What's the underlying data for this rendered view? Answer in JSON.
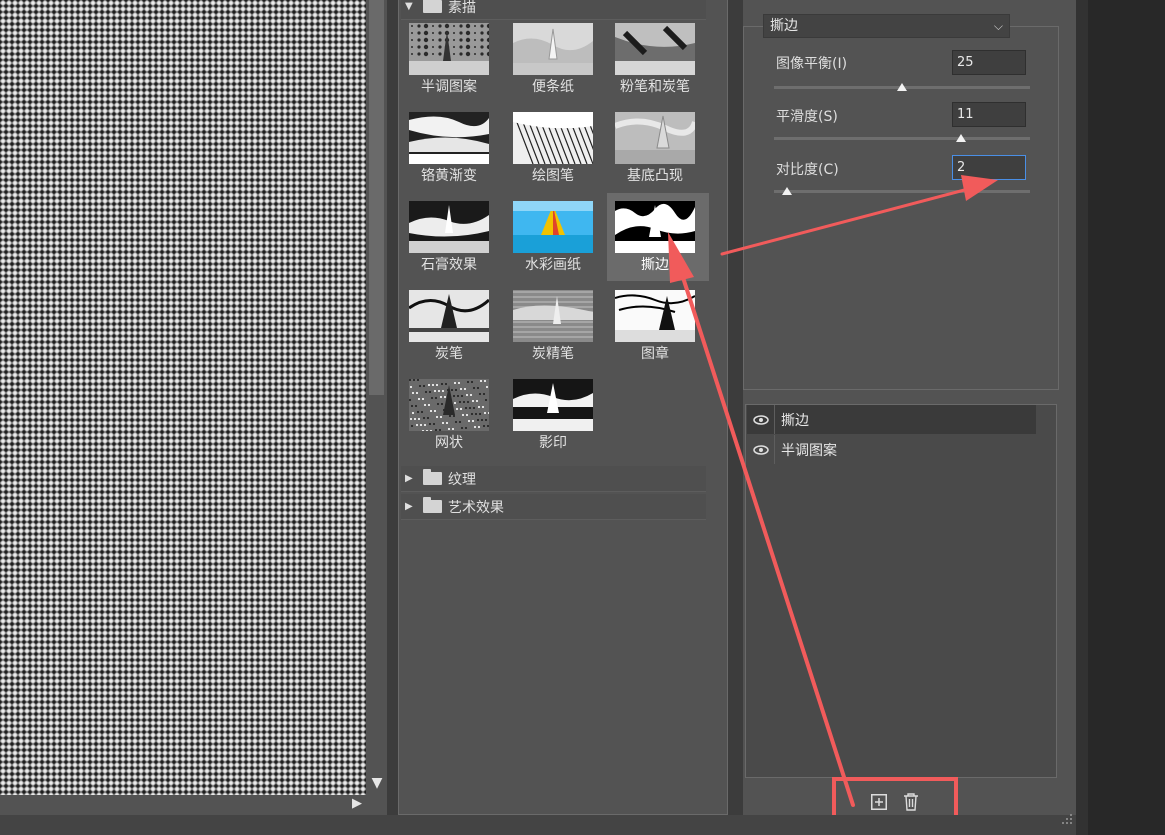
{
  "gallery": {
    "folders": [
      {
        "label": "素描",
        "expanded": true
      },
      {
        "label": "纹理",
        "expanded": false
      },
      {
        "label": "艺术效果",
        "expanded": false
      }
    ],
    "filters": [
      {
        "label": "半调图案",
        "icon": "halftone-thumb"
      },
      {
        "label": "便条纸",
        "icon": "note-paper-thumb"
      },
      {
        "label": "粉笔和炭笔",
        "icon": "chalk-charcoal-thumb"
      },
      {
        "label": "铬黄渐变",
        "icon": "chrome-thumb"
      },
      {
        "label": "绘图笔",
        "icon": "graphic-pen-thumb"
      },
      {
        "label": "基底凸现",
        "icon": "bas-relief-thumb"
      },
      {
        "label": "石膏效果",
        "icon": "plaster-thumb"
      },
      {
        "label": "水彩画纸",
        "icon": "water-paper-thumb"
      },
      {
        "label": "撕边",
        "icon": "torn-edges-thumb",
        "selected": true
      },
      {
        "label": "炭笔",
        "icon": "charcoal-thumb"
      },
      {
        "label": "炭精笔",
        "icon": "conte-crayon-thumb"
      },
      {
        "label": "图章",
        "icon": "stamp-thumb"
      },
      {
        "label": "网状",
        "icon": "reticulation-thumb"
      },
      {
        "label": "影印",
        "icon": "photocopy-thumb"
      }
    ]
  },
  "settings": {
    "selected_filter": "撕边",
    "params": [
      {
        "label": "图像平衡(I)",
        "value": "25",
        "slider_fraction": 0.5
      },
      {
        "label": "平滑度(S)",
        "value": "11",
        "slider_fraction": 0.73
      },
      {
        "label": "对比度(C)",
        "value": "2",
        "slider_fraction": 0.05,
        "focused": true
      }
    ]
  },
  "layers": [
    {
      "name": "撕边",
      "visible": true,
      "active": true
    },
    {
      "name": "半调图案",
      "visible": true,
      "active": false
    }
  ],
  "tools": {
    "new_layer_icon": "new-effect-layer-icon",
    "delete_icon": "trash-icon"
  },
  "colors": {
    "annotation": "#f15b5b",
    "focus": "#4a8fe6",
    "panel": "#535353"
  }
}
